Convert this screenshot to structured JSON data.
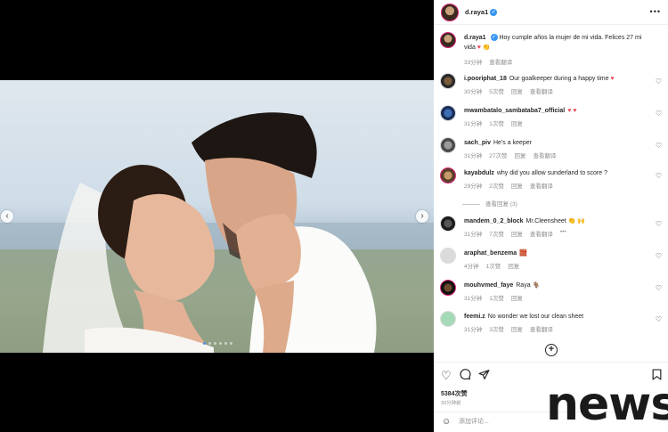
{
  "post": {
    "author": "d.raya1",
    "caption": "Hoy cumple años la mujer de mi vida. Felices 27 mi vida",
    "caption_emoji": "♥ 👏",
    "caption_time": "33分钟",
    "caption_translate": "查看翻译",
    "likes": "5384次赞",
    "posted": "33分钟前",
    "comment_placeholder": "添加评论..."
  },
  "comments": [
    {
      "user": "i.pooriphat_18",
      "text": "Our goalkeeper during a happy time",
      "emoji": "♥",
      "time": "30分钟",
      "likes": "5次赞",
      "reply": "回复",
      "translate": "查看翻译"
    },
    {
      "user": "mwambatalo_sambataba7_official",
      "text": "",
      "emoji": "♥ ♥",
      "time": "31分钟",
      "likes": "1次赞",
      "reply": "回复",
      "translate": ""
    },
    {
      "user": "sach_piv",
      "text": "He's a keeper",
      "emoji": "",
      "time": "31分钟",
      "likes": "27次赞",
      "reply": "回复",
      "translate": "查看翻译"
    },
    {
      "user": "kayabdulz",
      "text": "why did you allow sunderland to score ?",
      "emoji": "",
      "time": "29分钟",
      "likes": "2次赞",
      "reply": "回复",
      "translate": "查看翻译"
    },
    {
      "user": "mandem_0_2_block",
      "text": "Mr.Cleensheet",
      "emoji": "👏 🙌",
      "time": "31分钟",
      "likes": "7次赞",
      "reply": "回复",
      "translate": "查看翻译"
    },
    {
      "user": "araphat_benzema",
      "text": "",
      "emoji": "🧱",
      "time": "4分钟",
      "likes": "1次赞",
      "reply": "回复",
      "translate": ""
    },
    {
      "user": "mouhvmed_faye",
      "text": "Raya",
      "emoji": "🐐",
      "time": "31分钟",
      "likes": "1次赞",
      "reply": "回复",
      "translate": ""
    },
    {
      "user": "feemi.z",
      "text": "No wonder we lost our clean sheet",
      "emoji": "",
      "time": "31分钟",
      "likes": "3次赞",
      "reply": "回复",
      "translate": "查看翻译"
    }
  ],
  "view_replies": "查看回复 (3)",
  "more_glyph": "•••",
  "watermark": "news",
  "icons": {
    "heart": "heart-icon",
    "comment": "comment-icon",
    "share": "share-icon",
    "save": "bookmark-icon",
    "emoji": "emoji-icon",
    "load_more": "plus-circle-icon",
    "prev": "chevron-left-icon",
    "next": "chevron-right-icon"
  },
  "colors": {
    "verified": "#3897f0",
    "heart_red": "#ed4956",
    "text": "#262626",
    "muted": "#8e8e8e"
  }
}
